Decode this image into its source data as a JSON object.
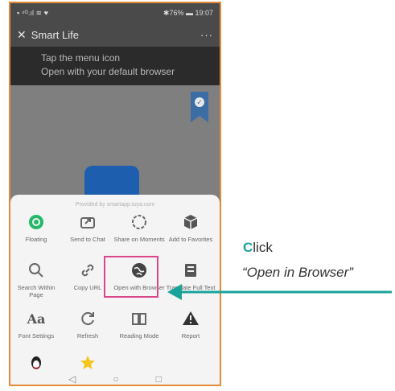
{
  "status": {
    "left_icons": "▪ ⁴ᴳ.ıl ≋ ♥",
    "battery": "✱76% ▬ 19:07"
  },
  "titlebar": {
    "close": "✕",
    "title": "Smart Life",
    "more": "···"
  },
  "overlay": {
    "line1": "Tap the menu icon",
    "line2": "Open with your default browser"
  },
  "sheet": {
    "provided": "Provided by smartapp.tuya.com",
    "row1": [
      {
        "label": "Floating",
        "icon": "circle-target-icon"
      },
      {
        "label": "Send to Chat",
        "icon": "share-box-icon"
      },
      {
        "label": "Share on Moments",
        "icon": "moments-icon"
      },
      {
        "label": "Add to Favorites",
        "icon": "cube-icon"
      }
    ],
    "row2": [
      {
        "label": "Search Within Page",
        "icon": "search-icon"
      },
      {
        "label": "Copy URL",
        "icon": "link-icon"
      },
      {
        "label": "Open with Browser",
        "icon": "globe-icon"
      },
      {
        "label": "Translate Full Text",
        "icon": "translate-icon"
      }
    ],
    "row3": [
      {
        "label": "Font Settings",
        "icon": "font-icon",
        "glyph": "Aa"
      },
      {
        "label": "Refresh",
        "icon": "refresh-icon"
      },
      {
        "label": "Reading Mode",
        "icon": "book-icon"
      },
      {
        "label": "Report",
        "icon": "warning-icon"
      }
    ],
    "row4": [
      {
        "label": "",
        "icon": "penguin-icon"
      },
      {
        "label": "",
        "icon": "star-icon"
      }
    ]
  },
  "annotation": {
    "click_first": "C",
    "click_rest": "lick",
    "target": "“Open in Browser”"
  },
  "colors": {
    "accent": "#1aa39a",
    "highlight": "#d9468a",
    "frame": "#e68a3c"
  }
}
